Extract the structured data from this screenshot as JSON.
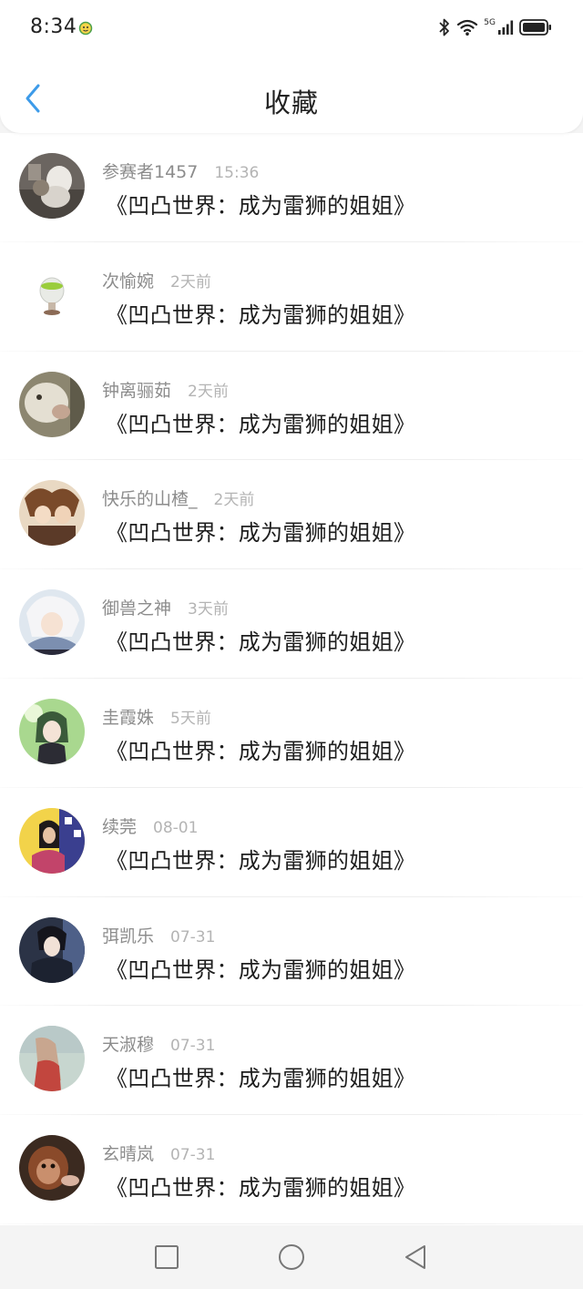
{
  "status_bar": {
    "time": "8:34",
    "network_label": "5G",
    "icons": [
      "app-notification-icon",
      "bluetooth-icon",
      "wifi-icon",
      "cellular-signal-icon",
      "battery-icon"
    ]
  },
  "header": {
    "title": "收藏",
    "back_icon": "chevron-left-icon",
    "accent_color": "#3d9be9"
  },
  "favorites": [
    {
      "username": "参赛者1457",
      "time": "15:36",
      "title": "《凹凸世界：成为雷狮的姐姐》",
      "avatar": "avatar-1"
    },
    {
      "username": "次愉婉",
      "time": "2天前",
      "title": "《凹凸世界：成为雷狮的姐姐》",
      "avatar": "avatar-2"
    },
    {
      "username": "钟离骊茹",
      "time": "2天前",
      "title": "《凹凸世界：成为雷狮的姐姐》",
      "avatar": "avatar-3"
    },
    {
      "username": "快乐的山楂_",
      "time": "2天前",
      "title": "《凹凸世界：成为雷狮的姐姐》",
      "avatar": "avatar-4"
    },
    {
      "username": "御兽之神",
      "time": "3天前",
      "title": "《凹凸世界：成为雷狮的姐姐》",
      "avatar": "avatar-5"
    },
    {
      "username": "圭霞姝",
      "time": "5天前",
      "title": "《凹凸世界：成为雷狮的姐姐》",
      "avatar": "avatar-6"
    },
    {
      "username": "续莞",
      "time": "08-01",
      "title": "《凹凸世界：成为雷狮的姐姐》",
      "avatar": "avatar-7"
    },
    {
      "username": "弭凯乐",
      "time": "07-31",
      "title": "《凹凸世界：成为雷狮的姐姐》",
      "avatar": "avatar-8"
    },
    {
      "username": "天淑穆",
      "time": "07-31",
      "title": "《凹凸世界：成为雷狮的姐姐》",
      "avatar": "avatar-9"
    },
    {
      "username": "玄晴岚",
      "time": "07-31",
      "title": "《凹凸世界：成为雷狮的姐姐》",
      "avatar": "avatar-10"
    }
  ],
  "system_nav": {
    "icons": [
      "recent-apps-square-icon",
      "home-circle-icon",
      "back-triangle-icon"
    ]
  }
}
